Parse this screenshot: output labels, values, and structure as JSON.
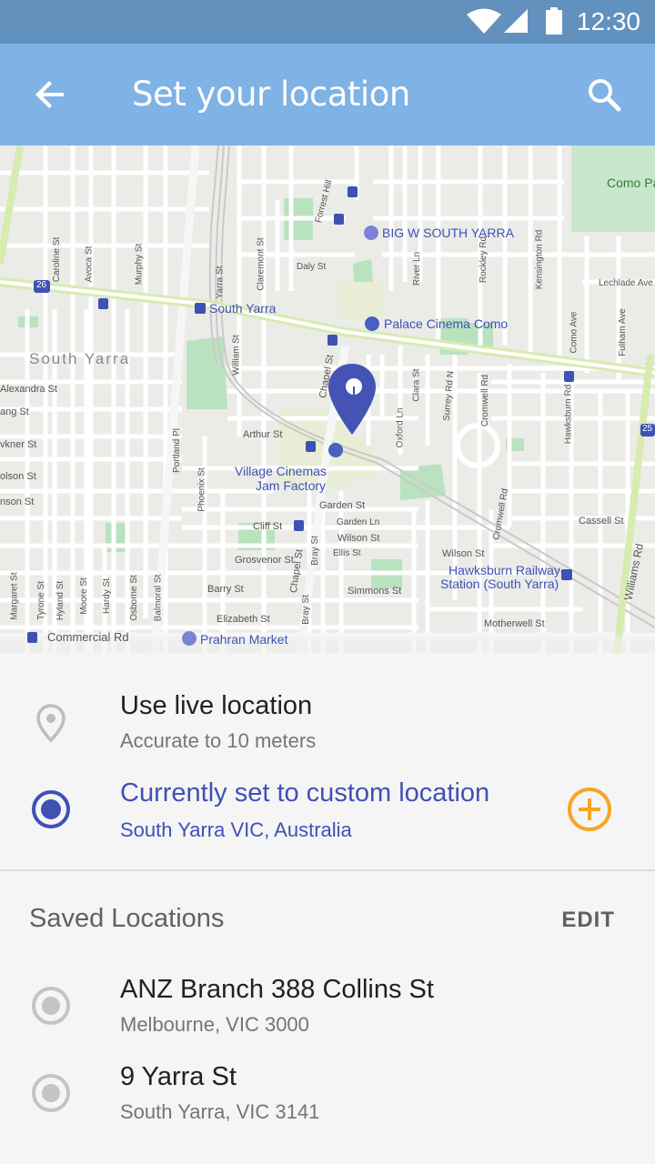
{
  "status_bar": {
    "time": "12:30",
    "icons": [
      "wifi-icon",
      "signal-icon",
      "battery-icon"
    ]
  },
  "app_bar": {
    "title": "Set your location",
    "back_icon": "arrow-back-icon",
    "search_icon": "search-icon"
  },
  "map": {
    "area_label": "South Yarra",
    "pois": {
      "big_w": "BIG W SOUTH YARRA",
      "south_yarra_station": "South Yarra",
      "palace_cinema": "Palace Cinema Como",
      "village_cinemas_1": "Village Cinemas",
      "village_cinemas_2": "Jam Factory",
      "hawksburn_1": "Hawksburn Railway",
      "hawksburn_2": "Station (South Yarra)",
      "prahran_market": "Prahran Market",
      "como_park": "Como Pa"
    },
    "streets": {
      "caroline": "Caroline St",
      "avoca": "Avoca St",
      "murphy": "Murphy St",
      "yarra": "Yarra St",
      "claremont": "Claremont St",
      "forrest_hill": "Forrest Hill",
      "daly": "Daly St",
      "river": "River Ln",
      "rockley": "Rockley Rd",
      "kensington": "Kensington Rd",
      "como_ave_top": "Como Ave",
      "lechlade": "Lechlade Ave",
      "como_ave": "Como Ave",
      "fulham": "Fulham Ave",
      "alexandra": "Alexandra St",
      "lang": "ang St",
      "arthur": "Arthur St",
      "vkner": "vkner St",
      "olson": "olson St",
      "nson": "nson St",
      "portland": "Portland Pl",
      "phoenix": "Phoenix St",
      "william": "William St",
      "chapel_top": "Chapel St",
      "chapel_bottom": "Chapel St",
      "clara": "Clara St",
      "oxford": "Oxford Ln",
      "surrey": "Surrey Rd N",
      "cromwell_top": "Cromwell Rd",
      "cromwell": "Cromwell Rd",
      "hawksburn": "Hawksburn Rd",
      "garden": "Garden St",
      "garden_ln": "Garden Ln",
      "cliff": "Cliff St",
      "wilson": "Wilson St",
      "wilson_east": "Wilson St",
      "ellis": "Ellis St",
      "grosvenor": "Grosvenor St",
      "simmons": "Simmons St",
      "barry": "Barry St",
      "elizabeth": "Elizabeth St",
      "bray": "Bray St",
      "bray_bottom": "Bray St",
      "motherwell": "Motherwell St",
      "cassell": "Cassell St",
      "williams": "Williams Rd",
      "commercial": "Commercial Rd",
      "margaret": "Margaret St",
      "tyrone": "Tyrone St",
      "hyland": "Hyland St",
      "moore": "Moore St",
      "hardy": "Hardy St",
      "osborne": "Osborne St",
      "balmoral": "Balmoral St",
      "route_26": "26",
      "route_25": "25"
    }
  },
  "options": {
    "live": {
      "title": "Use live location",
      "subtitle": "Accurate to 10 meters",
      "icon": "location-pin-icon"
    },
    "custom": {
      "title": "Currently set to custom location",
      "subtitle": "South Yarra VIC, Australia",
      "icon": "radio-selected-icon",
      "add_icon": "add-circle-icon"
    }
  },
  "saved": {
    "section_title": "Saved Locations",
    "edit_label": "EDIT",
    "items": [
      {
        "title": "ANZ Branch 388 Collins St",
        "subtitle": "Melbourne, VIC 3000"
      },
      {
        "title": "9 Yarra St",
        "subtitle": "South Yarra, VIC 3141"
      }
    ]
  },
  "colors": {
    "status_bar": "#6291bd",
    "app_bar": "#7fb2e5",
    "accent": "#3f51b5",
    "add_button": "#f5a623"
  }
}
